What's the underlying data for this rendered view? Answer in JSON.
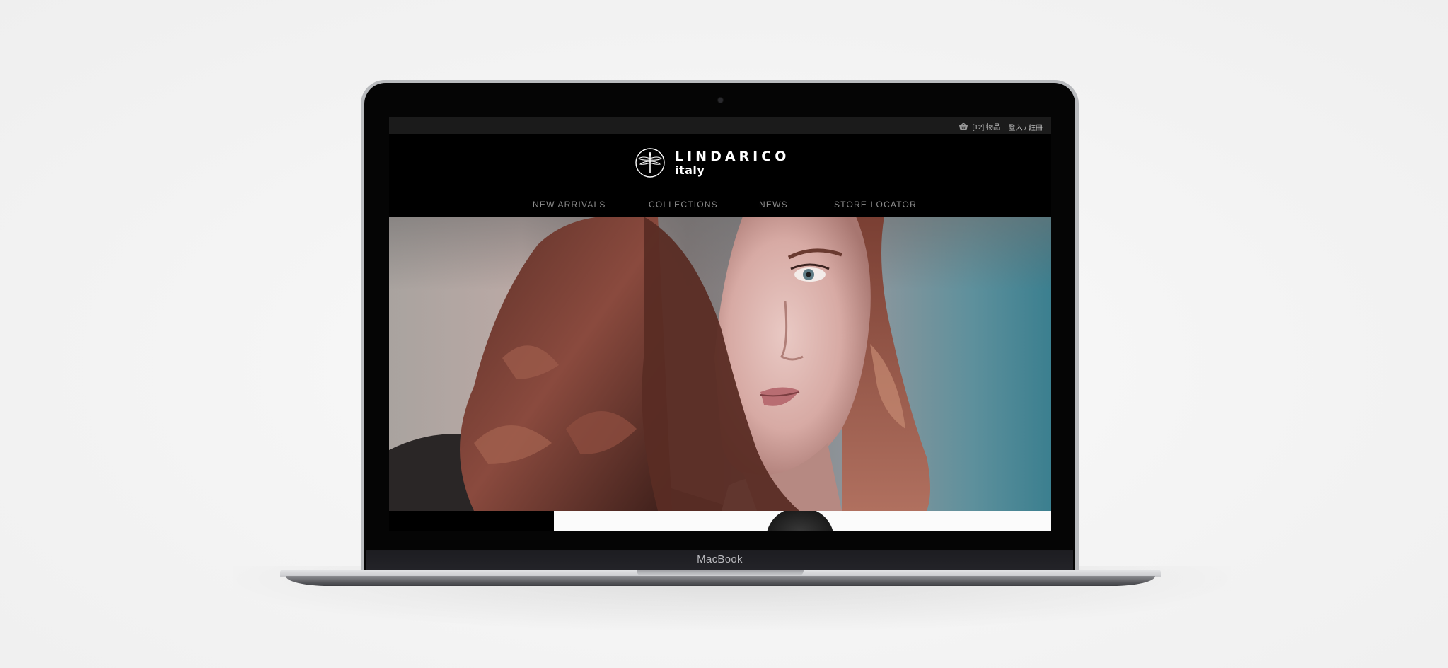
{
  "device": {
    "label": "MacBook"
  },
  "site": {
    "topbar": {
      "cart_icon": "basket-icon",
      "cart_text": "[12] 物品",
      "login_text": "登入 / 註冊"
    },
    "logo": {
      "mark_icon": "dragonfly-emblem-icon",
      "name": "LINDARICO",
      "sub": "italy"
    },
    "nav": {
      "items": [
        {
          "label": "NEW ARRIVALS"
        },
        {
          "label": "COLLECTIONS"
        },
        {
          "label": "NEWS"
        },
        {
          "label": "STORE LOCATOR"
        }
      ]
    },
    "hero": {
      "image": "woman-portrait-photo"
    }
  },
  "colors": {
    "page_background": "#f4f4f4",
    "site_background": "#000000",
    "topbar_background": "#1b1b1b",
    "nav_text": "#8e8e8e",
    "logo_text": "#ffffff"
  }
}
